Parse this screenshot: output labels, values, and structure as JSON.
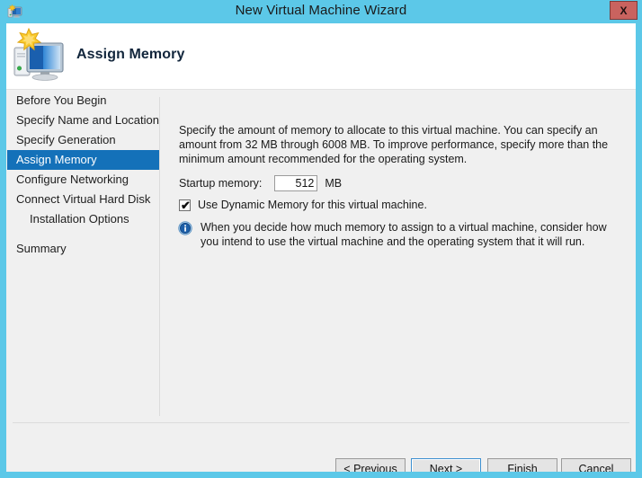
{
  "window": {
    "title": "New Virtual Machine Wizard",
    "icon": "virtual-machine-icon",
    "close_label": "X",
    "frame_color": "#5cc8e8"
  },
  "banner": {
    "title": "Assign Memory",
    "icon": "virtual-machine-icon"
  },
  "sidebar": {
    "items": [
      {
        "label": "Before You Begin",
        "selected": false,
        "indent": false
      },
      {
        "label": "Specify Name and Location",
        "selected": false,
        "indent": false
      },
      {
        "label": "Specify Generation",
        "selected": false,
        "indent": false
      },
      {
        "label": "Assign Memory",
        "selected": true,
        "indent": false
      },
      {
        "label": "Configure Networking",
        "selected": false,
        "indent": false
      },
      {
        "label": "Connect Virtual Hard Disk",
        "selected": false,
        "indent": false
      },
      {
        "label": "Installation Options",
        "selected": false,
        "indent": true
      },
      {
        "label": "Summary",
        "selected": false,
        "indent": false
      }
    ],
    "selected_color": "#1471b9"
  },
  "content": {
    "description": "Specify the amount of memory to allocate to this virtual machine. You can specify an amount from 32 MB through 6008 MB. To improve performance, specify more than the minimum amount recommended for the operating system.",
    "memory": {
      "label": "Startup memory:",
      "value": "512",
      "placeholder": "",
      "unit": "MB"
    },
    "dynamic_memory": {
      "label": "Use Dynamic Memory for this virtual machine.",
      "checked": true,
      "tick": "✔"
    },
    "note": {
      "icon": "info-icon",
      "text": "When you decide how much memory to assign to a virtual machine, consider how you intend to use the virtual machine and the operating system that it will run."
    }
  },
  "footer": {
    "buttons": [
      {
        "label": "< Previous",
        "default": false
      },
      {
        "label": "Next >",
        "default": true
      },
      {
        "label": "Finish",
        "default": false
      },
      {
        "label": "Cancel",
        "default": false
      }
    ]
  }
}
